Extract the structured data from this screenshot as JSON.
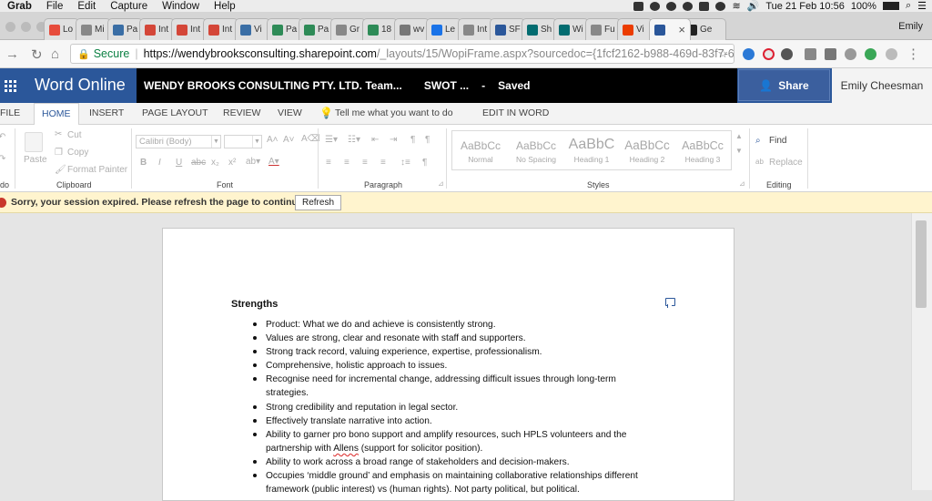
{
  "menubar": {
    "app": "Grab",
    "menus": [
      "File",
      "Edit",
      "Capture",
      "Window",
      "Help"
    ],
    "datetime": "Tue 21 Feb  10:56",
    "battery": "100%"
  },
  "browser": {
    "tabs": [
      {
        "label": "Lo",
        "icon": "vivaldi-icon",
        "color": "#e74c3c"
      },
      {
        "label": "Mi",
        "icon": "document-icon",
        "color": "#888888"
      },
      {
        "label": "Pa",
        "icon": "chart-icon",
        "color": "#3a6ea5"
      },
      {
        "label": "Int",
        "icon": "gmail-icon",
        "color": "#d44638"
      },
      {
        "label": "Int",
        "icon": "gmail-icon",
        "color": "#d44638"
      },
      {
        "label": "Int",
        "icon": "gmail-icon",
        "color": "#d44638"
      },
      {
        "label": "Vi",
        "icon": "check-icon",
        "color": "#3a6ea5"
      },
      {
        "label": "Pa",
        "icon": "chart-icon",
        "color": "#2e8b57"
      },
      {
        "label": "Pa",
        "icon": "chart-icon",
        "color": "#2e8b57"
      },
      {
        "label": "Gr",
        "icon": "document-icon",
        "color": "#888888"
      },
      {
        "label": "18",
        "icon": "chart-icon",
        "color": "#2e8b57"
      },
      {
        "label": "wv",
        "icon": "wv-icon",
        "color": "#777777"
      },
      {
        "label": "Le",
        "icon": "gear-icon",
        "color": "#1a73e8"
      },
      {
        "label": "Int",
        "icon": "lock-icon",
        "color": "#888888"
      },
      {
        "label": "SF",
        "icon": "sharepoint-icon",
        "color": "#2b579a"
      },
      {
        "label": "Sh",
        "icon": "sharepoint-icon",
        "color": "#036c70"
      },
      {
        "label": "Wi",
        "icon": "sharepoint-icon",
        "color": "#036c70"
      },
      {
        "label": "Fu",
        "icon": "document-icon",
        "color": "#888888"
      },
      {
        "label": "Vi",
        "icon": "office-icon",
        "color": "#eb3c00"
      },
      {
        "label": "",
        "icon": "word-icon",
        "color": "#2b579a"
      },
      {
        "label": "Ge",
        "icon": "star-icon",
        "color": "#222222"
      }
    ],
    "profile": "Emily",
    "url_secure_label": "Secure",
    "url_host": "https://wendybrooksconsulting.sharepoint.com",
    "url_path": "/_layouts/15/WopiFrame.aspx?sourcedoc={1fcf2162-b988-469d-83f7-67..."
  },
  "word": {
    "app_name": "Word Online",
    "org_title": "WENDY BROOKS CONSULTING PTY. LTD. Team...",
    "doc_name": "SWOT ...",
    "separator": "-",
    "save_status": "Saved",
    "share_label": "Share",
    "user_name": "Emily Cheesman",
    "colors": {
      "brand": "#2b579a",
      "notice": "#fff4ce"
    }
  },
  "ribbon": {
    "tabs": [
      "FILE",
      "HOME",
      "INSERT",
      "PAGE LAYOUT",
      "REVIEW",
      "VIEW"
    ],
    "active_tab": "HOME",
    "tell_me": "Tell me what you want to do",
    "edit_in_word": "EDIT IN WORD",
    "undo_label": "do",
    "clipboard": {
      "paste": "Paste",
      "cut": "Cut",
      "copy": "Copy",
      "format_painter": "Format Painter",
      "label": "Clipboard"
    },
    "font": {
      "name": "Calibri (Body)",
      "size": "",
      "bold": "B",
      "italic": "I",
      "underline": "U",
      "strike": "abc",
      "subscript": "x₂",
      "superscript": "x²",
      "label": "Font"
    },
    "paragraph": {
      "label": "Paragraph"
    },
    "styles": {
      "items": [
        {
          "sample": "AaBbCc",
          "name": "Normal"
        },
        {
          "sample": "AaBbCc",
          "name": "No Spacing"
        },
        {
          "sample": "AaBbC",
          "name": "Heading 1"
        },
        {
          "sample": "AaBbCc",
          "name": "Heading 2"
        },
        {
          "sample": "AaBbCc",
          "name": "Heading 3"
        }
      ],
      "label": "Styles"
    },
    "editing": {
      "find": "Find",
      "replace": "Replace",
      "label": "Editing"
    }
  },
  "notice": {
    "message": "Sorry, your session expired. Please refresh the page to continue.",
    "button": "Refresh"
  },
  "document": {
    "heading": "Strengths",
    "bullets": [
      [
        "Product: What we do and achieve is consistently strong."
      ],
      [
        "Values are strong, clear and resonate with staff and supporters."
      ],
      [
        "Strong track record, valuing experience, expertise, professionalism."
      ],
      [
        "Comprehensive, holistic approach to issues."
      ],
      [
        "Recognise need for incremental change, addressing difficult issues through long-term",
        "strategies."
      ],
      [
        "Strong credibility and reputation in legal sector."
      ],
      [
        "Effectively translate narrative into action."
      ],
      [
        "Ability to garner pro bono support and amplify resources, such HPLS volunteers and the",
        "partnership with Allens (support for solicitor position)."
      ],
      [
        "Ability to work across a broad range of stakeholders and decision-makers."
      ],
      [
        "Occupies ‘middle ground’ and emphasis on maintaining collaborative relationships different",
        "framework (public interest) vs (human rights). Not party political, but political."
      ]
    ]
  }
}
